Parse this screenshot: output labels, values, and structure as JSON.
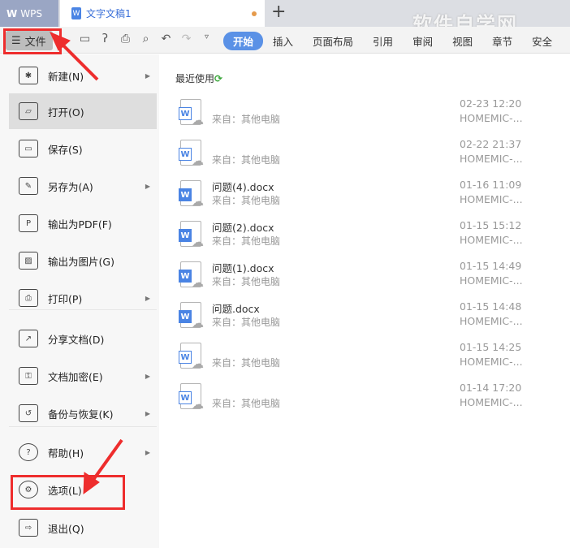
{
  "tabs": {
    "app": "WPS",
    "document": "文字文稿1",
    "new_tab": "+"
  },
  "watermark": "软件自学网",
  "toolbar": {
    "file_label": "文件",
    "ribbon": [
      "开始",
      "插入",
      "页面布局",
      "引用",
      "审阅",
      "视图",
      "章节",
      "安全"
    ]
  },
  "menu": [
    {
      "label": "新建(N)",
      "icon": "new-icon",
      "submenu": true
    },
    {
      "label": "打开(O)",
      "icon": "open-folder-icon",
      "submenu": false,
      "selected": true
    },
    {
      "label": "保存(S)",
      "icon": "save-icon",
      "submenu": false
    },
    {
      "label": "另存为(A)",
      "icon": "save-as-icon",
      "submenu": true
    },
    {
      "label": "输出为PDF(F)",
      "icon": "pdf-icon",
      "submenu": false
    },
    {
      "label": "输出为图片(G)",
      "icon": "image-icon",
      "submenu": false
    },
    {
      "label": "打印(P)",
      "icon": "print-icon",
      "submenu": true
    },
    {
      "label": "分享文档(D)",
      "icon": "share-icon",
      "submenu": false
    },
    {
      "label": "文档加密(E)",
      "icon": "encrypt-icon",
      "submenu": true
    },
    {
      "label": "备份与恢复(K)",
      "icon": "backup-icon",
      "submenu": true
    },
    {
      "label": "帮助(H)",
      "icon": "help-icon",
      "submenu": true
    },
    {
      "label": "选项(L)",
      "icon": "gear-icon",
      "submenu": false
    },
    {
      "label": "退出(Q)",
      "icon": "exit-icon",
      "submenu": false
    }
  ],
  "recent": {
    "title": "最近使用",
    "files": [
      {
        "name": "",
        "from": "来自：其他电脑",
        "time": "02-23 12:20",
        "host": "HOMEMIC-..."
      },
      {
        "name": "",
        "from": "来自：其他电脑",
        "time": "02-22 21:37",
        "host": "HOMEMIC-..."
      },
      {
        "name": "问题(4).docx",
        "from": "来自：其他电脑",
        "time": "01-16 11:09",
        "host": "HOMEMIC-..."
      },
      {
        "name": "问题(2).docx",
        "from": "来自：其他电脑",
        "time": "01-15 15:12",
        "host": "HOMEMIC-..."
      },
      {
        "name": "问题(1).docx",
        "from": "来自：其他电脑",
        "time": "01-15 14:49",
        "host": "HOMEMIC-..."
      },
      {
        "name": "问题.docx",
        "from": "来自：其他电脑",
        "time": "01-15 14:48",
        "host": "HOMEMIC-..."
      },
      {
        "name": "",
        "from": "来自：其他电脑",
        "time": "01-15 14:25",
        "host": "HOMEMIC-..."
      },
      {
        "name": "",
        "from": "来自：其他电脑",
        "time": "01-14 17:20",
        "host": "HOMEMIC-..."
      }
    ]
  },
  "colors": {
    "accent": "#5a91e6",
    "annotation": "#ee2d2d"
  }
}
